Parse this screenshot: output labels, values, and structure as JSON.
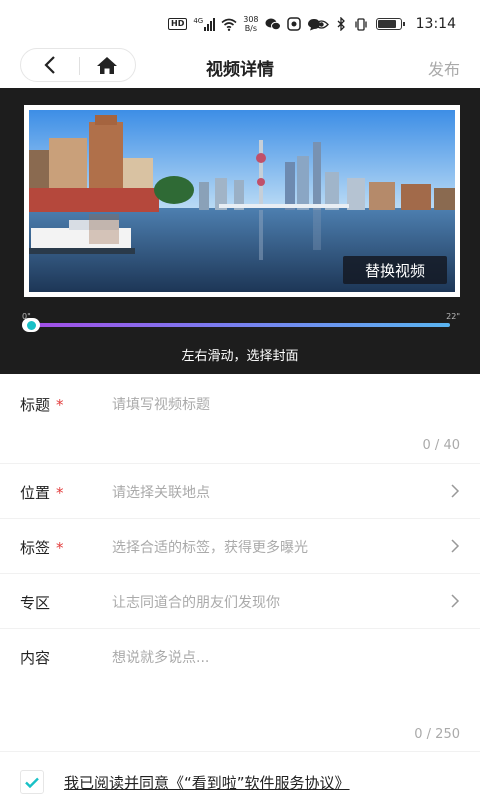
{
  "status_bar": {
    "hd": "HD",
    "net_type": "4G",
    "net_speed_value": "308",
    "net_speed_unit": "B/s",
    "time": "13:14",
    "battery_level": 0.85
  },
  "nav": {
    "title": "视频详情",
    "publish_label": "发布"
  },
  "video": {
    "replace_label": "替换视频",
    "time_start": "0\"",
    "time_end": "22\"",
    "slider_position": 0.0,
    "hint": "左右滑动，选择封面"
  },
  "form": {
    "title": {
      "label": "标题",
      "required_mark": "*",
      "placeholder": "请填写视频标题",
      "count": "0 / 40"
    },
    "location": {
      "label": "位置",
      "required_mark": "*",
      "placeholder": "请选择关联地点"
    },
    "tags": {
      "label": "标签",
      "required_mark": "*",
      "placeholder": "选择合适的标签，获得更多曝光"
    },
    "zone": {
      "label": "专区",
      "placeholder": "让志同道合的朋友们发现你"
    },
    "content": {
      "label": "内容",
      "placeholder": "想说就多说点...",
      "count": "0 / 250"
    }
  },
  "agreement": {
    "text": "我已阅读并同意《“看到啦”软件服务协议》",
    "checked": true
  },
  "colors": {
    "accent": "#19c1c6",
    "required": "#e23c3c",
    "video_bg": "#1d1d1d"
  }
}
